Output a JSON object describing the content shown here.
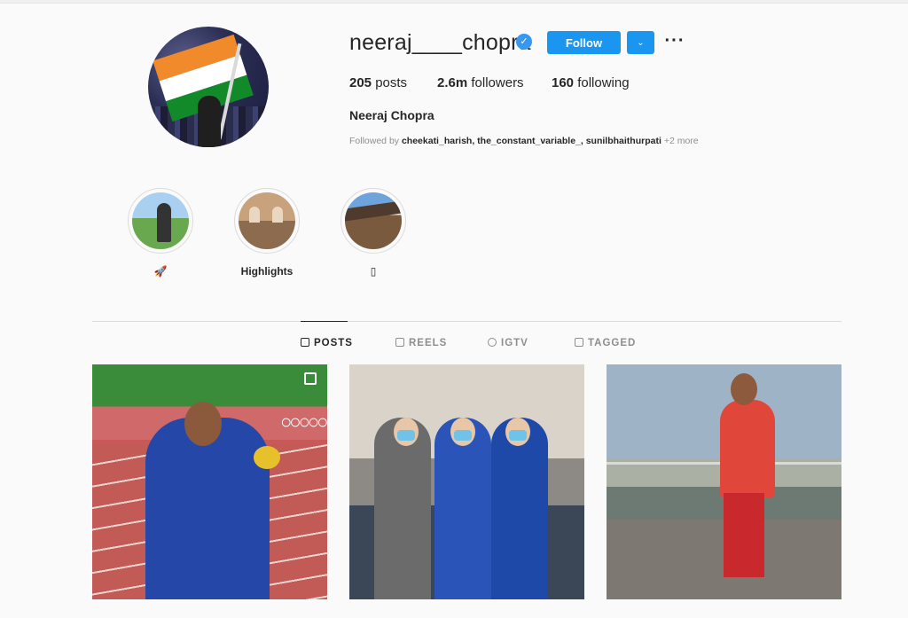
{
  "profile": {
    "username": "neeraj____chopra",
    "verified_mark": "✓",
    "follow_label": "Follow",
    "dropdown_glyph": "⌄",
    "more_glyph": "···",
    "full_name": "Neeraj Chopra",
    "stats": {
      "posts_count": "205",
      "posts_label": "posts",
      "followers_count": "2.6m",
      "followers_label": "followers",
      "following_count": "160",
      "following_label": "following"
    },
    "followed_by_prefix": "Followed by",
    "followed_by_names": "cheekati_harish, the_constant_variable_, sunilbhaithurpati",
    "followed_by_more": "+2 more"
  },
  "highlights": [
    {
      "label": "🚀"
    },
    {
      "label": "Highlights"
    },
    {
      "label": "▯"
    }
  ],
  "tabs": [
    {
      "label": "POSTS",
      "active": true
    },
    {
      "label": "REELS",
      "active": false
    },
    {
      "label": "IGTV",
      "active": false
    },
    {
      "label": "TAGGED",
      "active": false
    }
  ],
  "colors": {
    "accent": "#1a95f0",
    "verified": "#3897f0",
    "background": "#fafafa",
    "text": "#262626",
    "muted": "#8e8e8e"
  },
  "icons": {
    "posts_tab": "grid-icon",
    "reels_tab": "reels-icon",
    "igtv_tab": "igtv-icon",
    "tagged_tab": "tagged-icon",
    "multi_post": "multiple-photos-icon"
  }
}
